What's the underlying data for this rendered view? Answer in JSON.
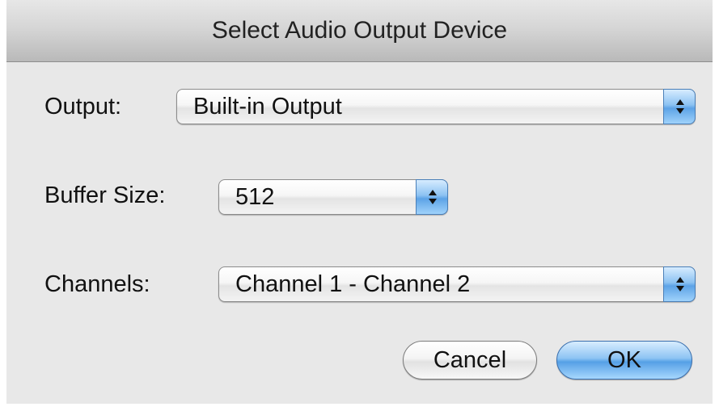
{
  "dialog": {
    "title": "Select Audio Output Device"
  },
  "output": {
    "label": "Output:",
    "value": "Built-in Output"
  },
  "buffer_size": {
    "label": "Buffer Size:",
    "value": "512"
  },
  "channels": {
    "label": "Channels:",
    "value": "Channel 1 - Channel 2"
  },
  "buttons": {
    "cancel": "Cancel",
    "ok": "OK"
  },
  "icons": {
    "popup_stepper": "up-down-arrows-icon"
  },
  "colors": {
    "accent_blue": "#5da3e6",
    "window_bg": "#e8e8e8"
  }
}
